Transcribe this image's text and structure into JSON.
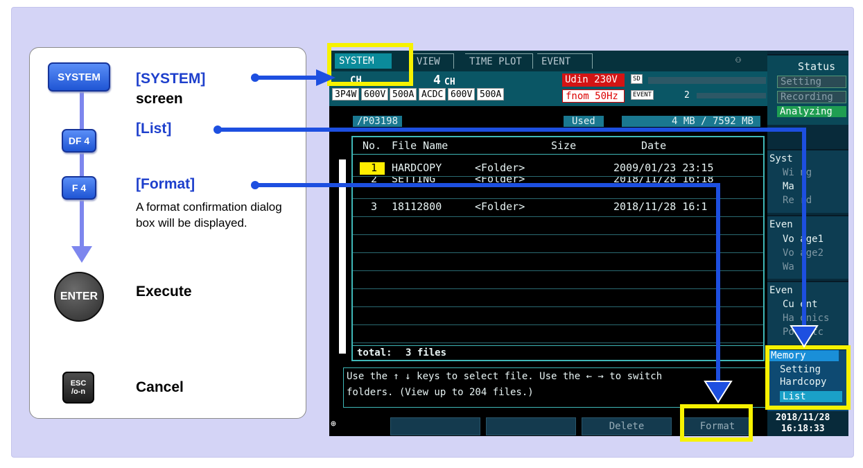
{
  "steps": {
    "system": {
      "key": "SYSTEM",
      "title": "[SYSTEM]",
      "subtitle": "screen"
    },
    "list": {
      "key": "DF 4",
      "title": "[List]"
    },
    "format": {
      "key": "F 4",
      "title": "[Format]",
      "description": "A format confirmation dialog box will be displayed."
    },
    "execute": {
      "key": "ENTER",
      "title": "Execute"
    },
    "cancel": {
      "key_top": "ESC",
      "key_bottom": "/o-n",
      "title": "Cancel"
    }
  },
  "screen": {
    "tabs": [
      "SYSTEM",
      "VIEW",
      "TIME PLOT",
      "EVENT"
    ],
    "ch_left": {
      "label": "CH",
      "wiring": "3P4W",
      "voltage": "600V",
      "current": "500A"
    },
    "ch4": {
      "num": "4",
      "label": "CH",
      "coupling": "ACDC",
      "voltage": "600V",
      "current": "500A"
    },
    "udin": "Udin 230V",
    "fnom": "fnom  50Hz",
    "sd_label": "SD",
    "event_label": "EVENT",
    "event_count": "2",
    "path": "/P03198",
    "used_label": "Used",
    "used_value": "4 MB /  7592 MB",
    "list_headers": {
      "no": "No.",
      "name": "File Name",
      "size": "Size",
      "date": "Date"
    },
    "files": [
      {
        "no": "1",
        "name": "HARDCOPY",
        "size": "<Folder>",
        "date": "2009/01/23 23:15"
      },
      {
        "no": "2",
        "name": "SETTING",
        "size": "<Folder>",
        "date": "2018/11/28 16:18"
      },
      {
        "no": "3",
        "name": "18112800",
        "size": "<Folder>",
        "date": "2018/11/28 16:1"
      }
    ],
    "total_label": "total:",
    "total_value": "3 files",
    "help_line1": "Use the ↑ ↓ keys to select file. Use the ← → to switch",
    "help_line2": "folders.  (View up to 204 files.)",
    "fkeys": [
      "",
      "",
      "Delete",
      "Format"
    ],
    "datetime_date": "2018/11/28",
    "datetime_time": "16:18:33",
    "side": {
      "status_title": "Status",
      "status_items": [
        "Setting",
        "Recording",
        "Analyzing"
      ],
      "system_title": "Syst",
      "system_items": [
        "Wi   ng",
        "Ma",
        "Re    rd"
      ],
      "event1_title": "Even",
      "event1_items": [
        "Vo   age1",
        "Vo   age2",
        "Wa"
      ],
      "event2_title": "Even",
      "event2_items": [
        "Cu   ent",
        "Ha   onics",
        "Po   /etc"
      ],
      "memory_title": "Memory",
      "memory_items": [
        "Setting",
        "Hardcopy",
        "List"
      ]
    }
  }
}
